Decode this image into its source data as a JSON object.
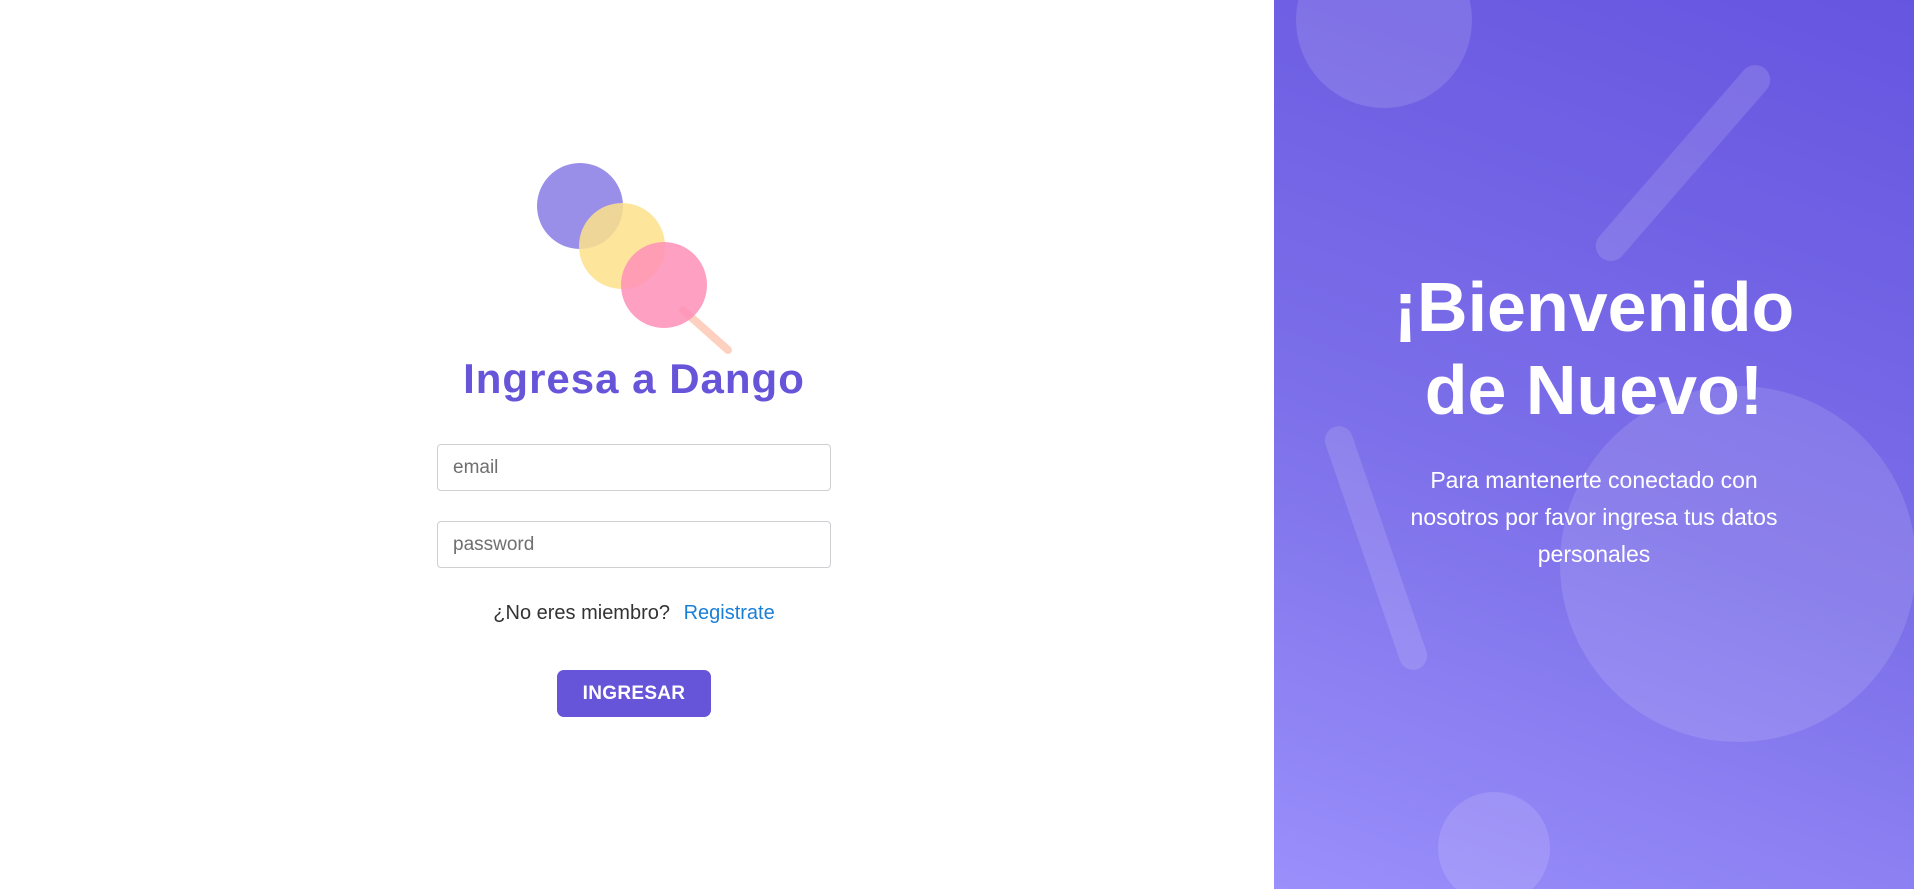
{
  "login": {
    "title": "Ingresa a Dango",
    "email_placeholder": "email",
    "password_placeholder": "password",
    "not_member_text": "¿No eres miembro?",
    "register_link": "Registrate",
    "submit_label": "INGRESAR",
    "logo": "dango-logo-icon"
  },
  "welcome_panel": {
    "heading_line1": "¡Bienvenido",
    "heading_line2": "de Nuevo!",
    "subtitle": "Para mantenerte conectado con nosotros por favor ingresa tus datos personales"
  },
  "colors": {
    "accent": "#6654d9",
    "link": "#1a7fd6",
    "panel_gradient_start": "#6655e0",
    "panel_gradient_end": "#9a8ffb",
    "dango_purple": "#8b80e6",
    "dango_yellow": "#fde28a",
    "dango_pink": "#fe8fb7",
    "stick": "#fdd0c0"
  }
}
